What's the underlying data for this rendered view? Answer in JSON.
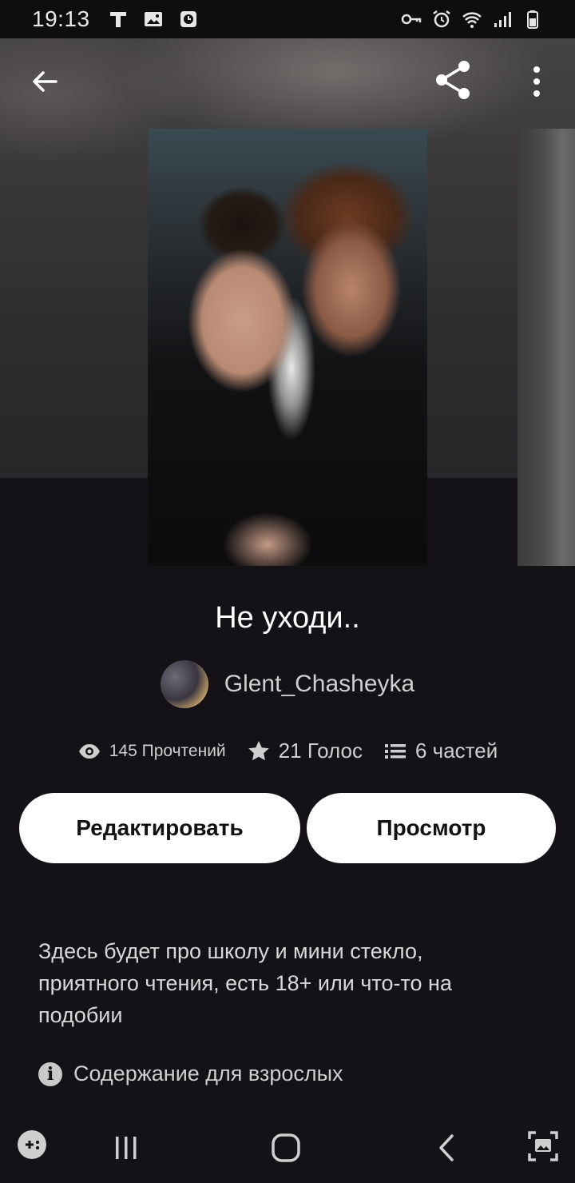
{
  "status_bar": {
    "time": "19:13",
    "left_icons": [
      "t-icon",
      "image-icon",
      "clock-app-icon"
    ],
    "right_icons": [
      "key-icon",
      "alarm-icon",
      "wifi-icon",
      "signal-icon",
      "battery-icon"
    ]
  },
  "app_bar": {
    "back_icon": "arrow-left-icon",
    "share_icon": "share-icon",
    "more_icon": "more-vertical-icon"
  },
  "story": {
    "title": "Не уходи..",
    "author": "Glent_Chasheyka",
    "stats": {
      "reads": "145 Прочтений",
      "votes": "21 Голос",
      "parts": "6 частей"
    },
    "buttons": {
      "edit": "Редактировать",
      "view": "Просмотр"
    },
    "description": "Здесь будет про школу и мини стекло, приятного чтения, есть 18+ или что-то на подобии",
    "mature_label": "Содержание для взрослых",
    "mature_icon_glyph": "i"
  },
  "nav_bar": {
    "items": [
      "game-launcher-icon",
      "recent-apps-icon",
      "home-icon",
      "back-icon",
      "screenshot-icon"
    ]
  },
  "colors": {
    "background": "#141216",
    "button_bg": "#ffffff",
    "text_primary": "#ffffff",
    "text_secondary": "#cfcfcf"
  }
}
